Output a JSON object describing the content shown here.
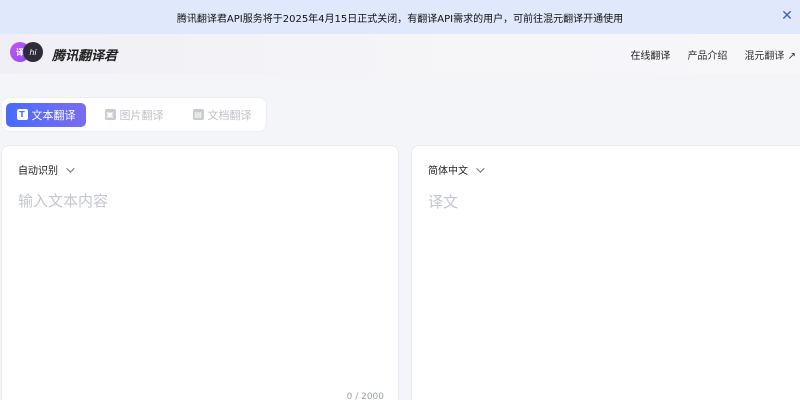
{
  "banner": {
    "text": "腾讯翻译君API服务将于2025年4月15日正式关闭，有翻译API需求的用户，可前往混元翻译开通使用",
    "close_icon": "close-icon"
  },
  "header": {
    "logo_badge_left": "译",
    "logo_badge_right": "hi",
    "brand": "腾讯翻译君",
    "nav": [
      {
        "label": "在线翻译"
      },
      {
        "label": "产品介绍"
      },
      {
        "label": "混元翻译 ↗"
      }
    ]
  },
  "tabs": [
    {
      "label": "文本翻译",
      "icon": "text-doc-icon",
      "icon_glyph": "T",
      "active": true
    },
    {
      "label": "图片翻译",
      "icon": "image-icon",
      "icon_glyph": "▣",
      "active": false
    },
    {
      "label": "文档翻译",
      "icon": "document-icon",
      "icon_glyph": "▤",
      "active": false
    }
  ],
  "source": {
    "language": "自动识别",
    "placeholder": "输入文本内容",
    "value": "",
    "counter": "0 / 2000"
  },
  "target": {
    "language": "简体中文",
    "placeholder": "译文"
  },
  "colors": {
    "banner_bg": "#dfe9fb",
    "accent_start": "#4a6bff",
    "accent_end": "#7a6cf0",
    "placeholder": "#c4c7cf"
  }
}
